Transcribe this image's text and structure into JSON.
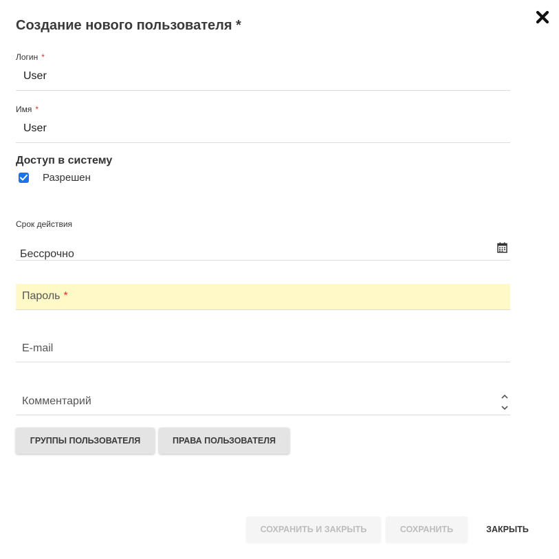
{
  "dialog": {
    "title": "Создание нового пользователя *",
    "close_icon": "close-x-icon"
  },
  "fields": {
    "login": {
      "label": "Логин",
      "required_mark": "*",
      "value": "User"
    },
    "name": {
      "label": "Имя",
      "required_mark": "*",
      "value": "User"
    }
  },
  "access": {
    "title": "Доступ в систему",
    "checkbox_label": "Разрешен",
    "checked": true
  },
  "validity": {
    "label": "Срок действия",
    "value": "Бессрочно",
    "icon": "calendar-icon"
  },
  "password": {
    "placeholder": "Пароль",
    "required_mark": "*",
    "highlight_color": "#fff9c7"
  },
  "email": {
    "placeholder": "E-mail"
  },
  "comment": {
    "placeholder": "Комментарий"
  },
  "buttons": {
    "user_groups": "ГРУППЫ ПОЛЬЗОВАТЕЛЯ",
    "user_rights": "ПРАВА ПОЛЬЗОВАТЕЛЯ",
    "save_and_close": "СОХРАНИТЬ И ЗАКРЫТЬ",
    "save": "СОХРАНИТЬ",
    "close": "ЗАКРЫТЬ"
  },
  "colors": {
    "accent": "#1a73e8",
    "required": "#d9342b",
    "button_bg": "#e4e4e4",
    "disabled_text": "#bdbdbd"
  }
}
